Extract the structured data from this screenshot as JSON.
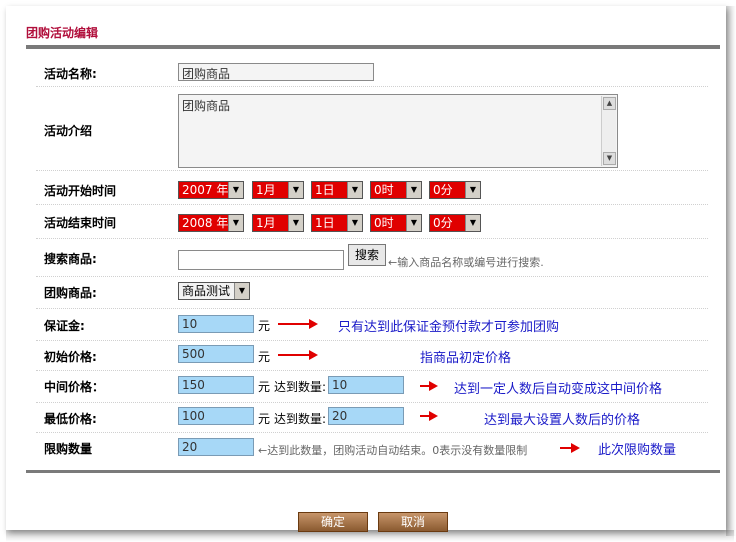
{
  "page_title": "团购活动编辑",
  "fields": {
    "name": {
      "label": "活动名称:",
      "value": "团购商品"
    },
    "intro": {
      "label": "活动介绍",
      "value": "团购商品"
    },
    "start_time": {
      "label": "活动开始时间",
      "year": "2007 年",
      "month": "1月",
      "day": "1日",
      "hour": "0时",
      "minute": "0分"
    },
    "end_time": {
      "label": "活动结束时间",
      "year": "2008 年",
      "month": "1月",
      "day": "1日",
      "hour": "0时",
      "minute": "0分"
    },
    "search": {
      "label": "搜索商品:",
      "value": "",
      "button": "搜索",
      "hint": "←输入商品名称或编号进行搜索."
    },
    "goods": {
      "label": "团购商品:",
      "selected": "商品测试"
    },
    "deposit": {
      "label": "保证金:",
      "value": "10",
      "unit": "元",
      "note": "只有达到此保证金预付款才可参加团购"
    },
    "initial_price": {
      "label": "初始价格:",
      "value": "500",
      "unit": "元",
      "note": "指商品初定价格"
    },
    "middle_price": {
      "label": "中间价格：",
      "value": "150",
      "unit": "元",
      "qty_label": "达到数量:",
      "qty": "10",
      "note": "达到一定人数后自动变成这中间价格"
    },
    "lowest_price": {
      "label": "最低价格:",
      "value": "100",
      "unit": "元",
      "qty_label": "达到数量:",
      "qty": "20",
      "note": "达到最大设置人数后的价格"
    },
    "limit": {
      "label": "限购数量",
      "value": "20",
      "hint": "←达到此数量，团购活动自动结束。0表示没有数量限制",
      "note": "此次限购数量"
    }
  },
  "footer": {
    "confirm": "确定",
    "cancel": "取消"
  },
  "colors": {
    "title": "#b10e3b",
    "select_red": "#e00000",
    "note_blue": "#1a1ac8",
    "input_blue": "#a7d8f7"
  }
}
